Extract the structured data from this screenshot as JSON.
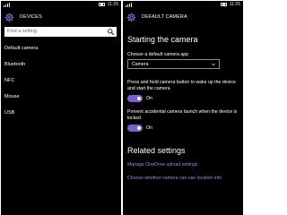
{
  "status_bar": {
    "time": "11:25"
  },
  "devices": {
    "title": "DEVICES",
    "search_placeholder": "Find a setting",
    "items": [
      {
        "label": "Default camera"
      },
      {
        "label": "Bluetooth"
      },
      {
        "label": "NFC"
      },
      {
        "label": "Mouse"
      },
      {
        "label": "USB"
      }
    ]
  },
  "default_camera": {
    "title": "DEFAULT CAMERA",
    "section_title": "Starting the camera",
    "choose_label": "Choose a default camera app",
    "selected_app": "Camera",
    "wake_label": "Press and hold camera button to wake up the device and start the camera",
    "wake_state": "On",
    "prevent_label": "Prevent accidental camera launch when the device is locked",
    "prevent_state": "On",
    "related_title": "Related settings",
    "links": [
      {
        "label": "Manage OneDrive upload settings"
      },
      {
        "label": "Choose whether camera can use location info"
      }
    ]
  },
  "colors": {
    "accent": "#7b5fd0",
    "link": "#9f86e4",
    "background": "#000000"
  },
  "icons": [
    "gear-icon",
    "search-icon",
    "chevron-down-icon",
    "signal-icon",
    "battery-icon"
  ]
}
